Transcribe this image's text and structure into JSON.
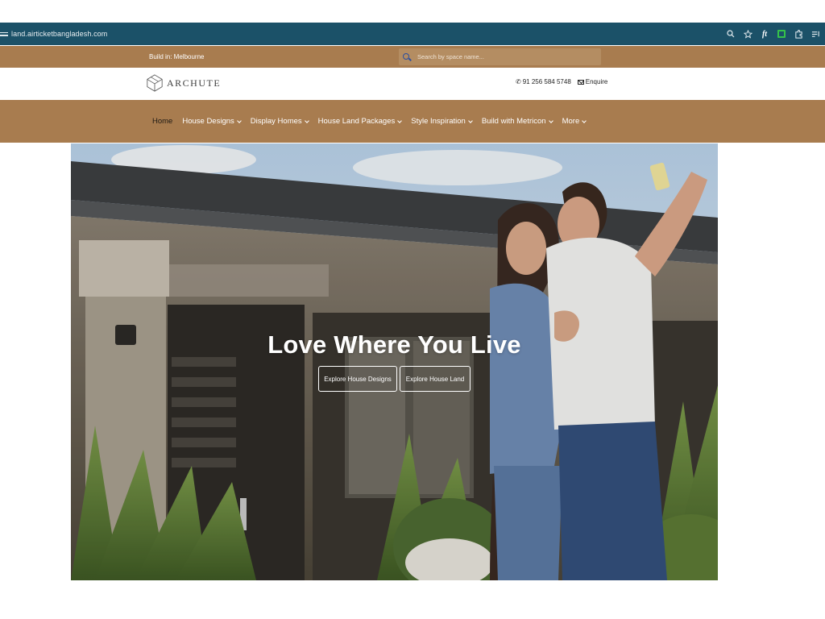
{
  "browser": {
    "url": "land.airticketbangladesh.com",
    "icons": [
      "site-info-icon",
      "zoom-icon",
      "star-icon",
      "extension-ft-icon",
      "extension-green-icon",
      "extensions-puzzle-icon",
      "reading-list-icon"
    ]
  },
  "topbar": {
    "build_in": "Build in: Melbourne",
    "search_placeholder": "Search by space name..."
  },
  "header": {
    "logo_text": "ARCHUTE",
    "phone": "91 256 584 5748",
    "enquire": "Enquire"
  },
  "nav": {
    "items": [
      {
        "label": "Home",
        "active": true
      },
      {
        "label": "House Designs"
      },
      {
        "label": "Display Homes"
      },
      {
        "label": "House Land Packages"
      },
      {
        "label": "Style Inspiration"
      },
      {
        "label": "Build with Metricon"
      },
      {
        "label": "More"
      }
    ]
  },
  "hero": {
    "title": "Love Where You Live",
    "buttons": [
      "Explore House Designs",
      "Explore House Land"
    ]
  },
  "colors": {
    "browser_bar": "#1b5168",
    "brand_brown": "#a87c4f",
    "search_bg": "#b48d62"
  }
}
